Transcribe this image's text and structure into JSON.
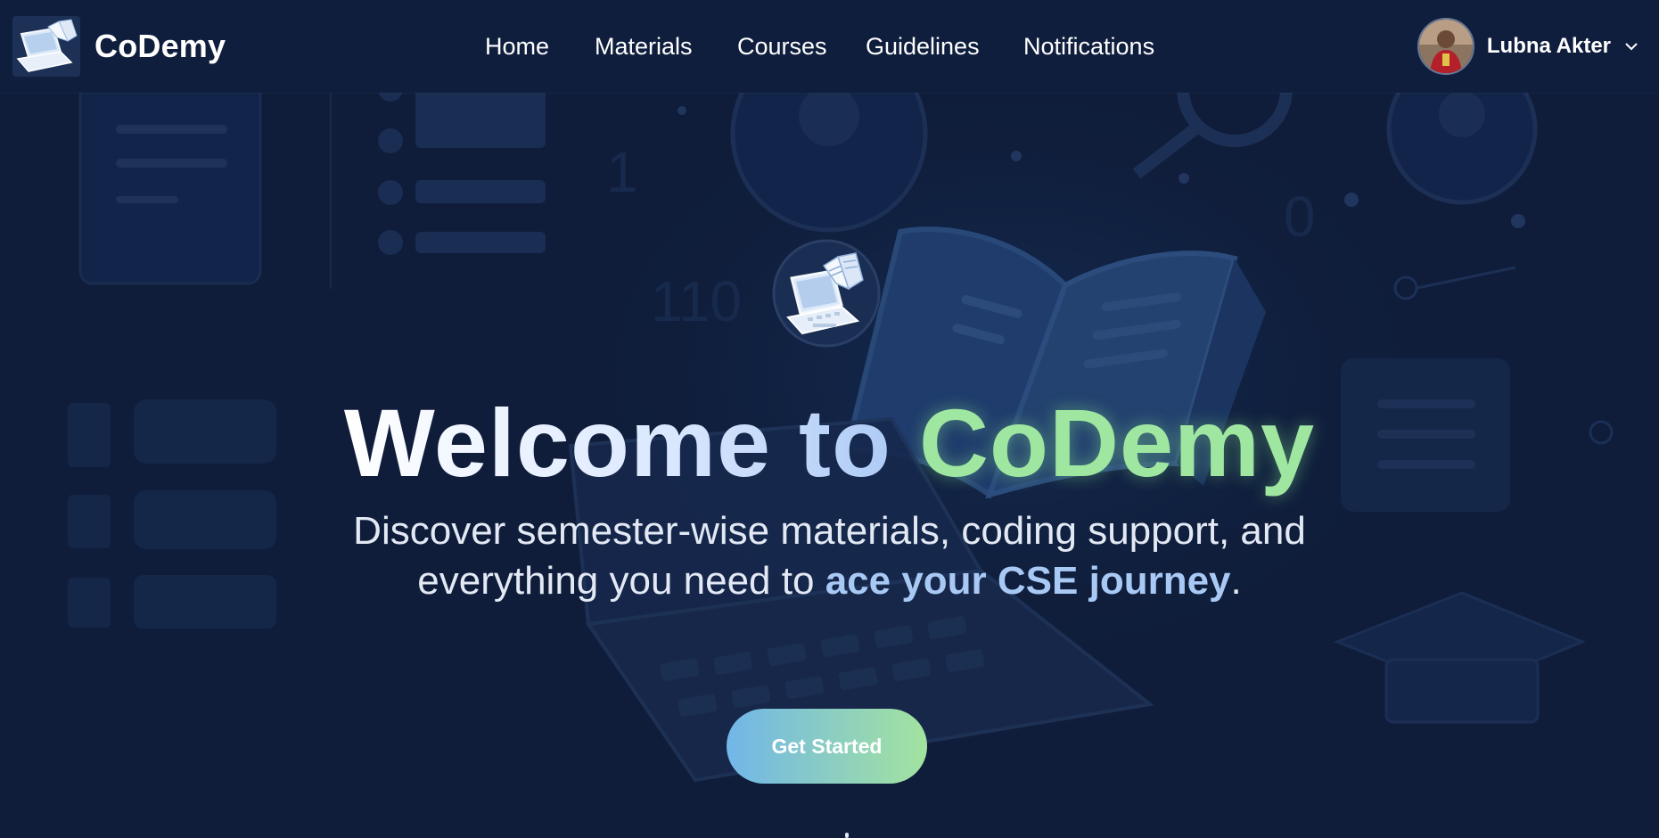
{
  "brand": {
    "name": "CoDemy",
    "logo_icon": "laptop-book-icon"
  },
  "nav": {
    "items": [
      {
        "label": "Home"
      },
      {
        "label": "Materials"
      },
      {
        "label": "Courses"
      },
      {
        "label": "Guidelines"
      },
      {
        "label": "Notifications"
      }
    ]
  },
  "user": {
    "name": "Lubna Akter",
    "avatar_icon": "avatar",
    "menu_icon": "chevron-down-icon"
  },
  "hero": {
    "icon": "laptop-book-icon",
    "title_part1": "Welcome to ",
    "title_part2": "CoDemy",
    "subtitle_line1": "Discover semester-wise materials, coding support, and",
    "subtitle_line2_prefix": "everything you need to ",
    "subtitle_highlight": "ace your CSE journey",
    "subtitle_suffix": ".",
    "cta_label": "Get Started"
  },
  "colors": {
    "background": "#0f1d3a",
    "navbar": "#0f1e3d",
    "accent_green": "#9fe7a1",
    "accent_blue": "#a9c9f5",
    "cta_gradient_start": "#71b6e8",
    "cta_gradient_end": "#a3e39f"
  }
}
